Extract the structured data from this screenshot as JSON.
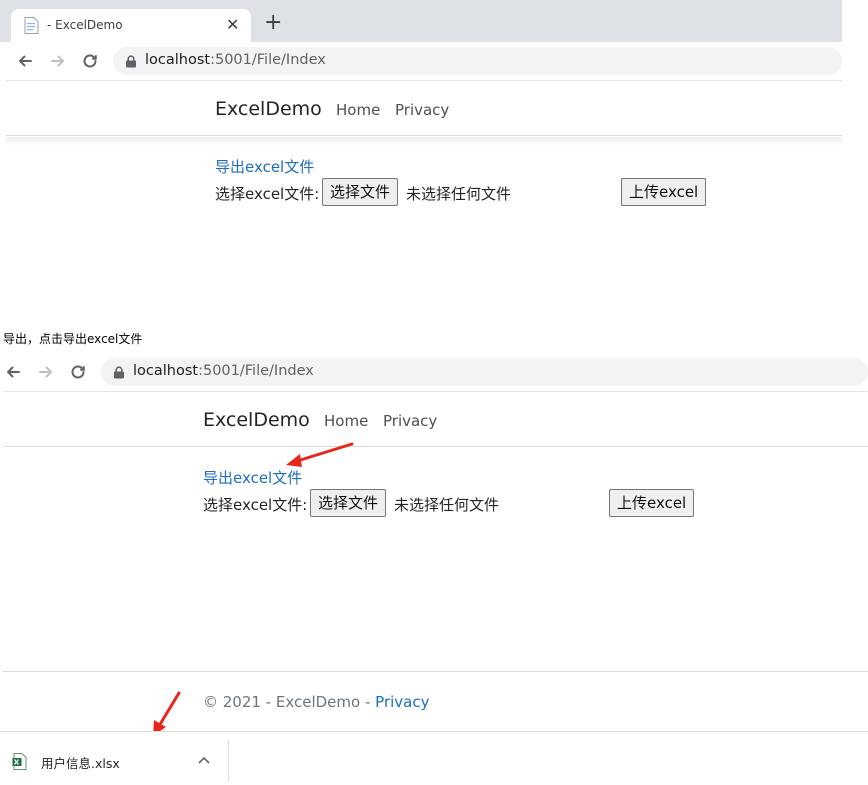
{
  "top": {
    "tab_title": "- ExcelDemo",
    "tab_close": "✕",
    "new_tab": "+",
    "url_host": "localhost",
    "url_rest": ":5001/File/Index",
    "brand": "ExcelDemo",
    "nav": [
      "Home",
      "Privacy"
    ],
    "export_link": "导出excel文件",
    "choose_label": "选择excel文件:",
    "choose_button": "选择文件",
    "file_status": "未选择任何文件",
    "upload_button": "上传excel"
  },
  "caption": "导出，点击导出excel文件",
  "bottom": {
    "url_host": "localhost",
    "url_rest": ":5001/File/Index",
    "brand": "ExcelDemo",
    "nav": [
      "Home",
      "Privacy"
    ],
    "export_link": "导出excel文件",
    "choose_label": "选择excel文件:",
    "choose_button": "选择文件",
    "file_status": "未选择任何文件",
    "upload_button": "上传excel",
    "footer_text": "© 2021 - ExcelDemo - ",
    "footer_link": "Privacy",
    "download_file": "用户信息.xlsx"
  },
  "colors": {
    "link": "#1b6ec2",
    "annotation_arrow": "#e8261b",
    "tabstrip": "#dee1e6"
  },
  "icons": [
    "page-favicon-icon",
    "back-arrow-icon",
    "forward-arrow-icon",
    "reload-icon",
    "lock-icon",
    "excel-file-icon",
    "chevron-up-icon"
  ]
}
